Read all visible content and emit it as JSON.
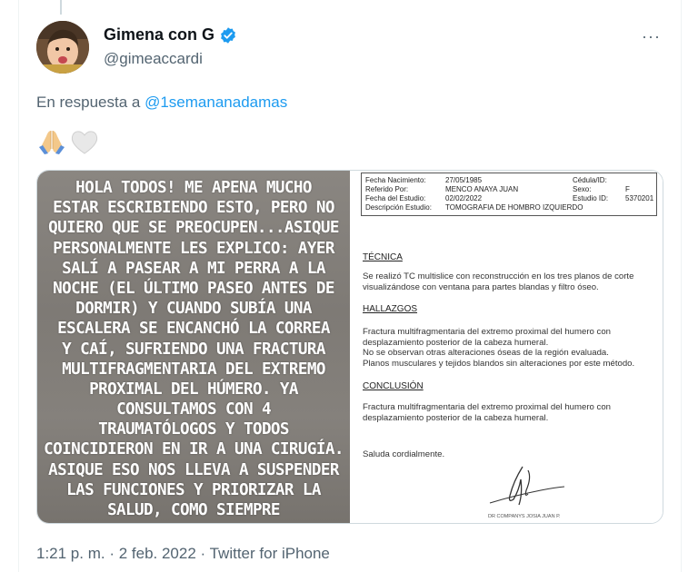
{
  "tweet": {
    "author_name": "Gimena con G",
    "author_handle": "@gimeaccardi",
    "more_menu_label": "···",
    "reply_prefix": "En respuesta a",
    "reply_to": "@1semananadamas",
    "emojis": [
      "pray-emoji",
      "white-heart-emoji"
    ],
    "time": "1:21 p. m.",
    "separator": " · ",
    "date": "2 feb. 2022",
    "source": "Twitter for iPhone"
  },
  "media": {
    "story_lines": [
      "HOLA TODOS! ME APENA MUCHO",
      "ESTAR ESCRIBIENDO ESTO, PERO NO",
      "QUIERO QUE SE PREOCUPEN...ASIQUE",
      "PERSONALMENTE LES EXPLICO: AYER",
      "SALÍ A PASEAR A MI PERRA A LA",
      "NOCHE (EL ÚLTIMO PASEO ANTES DE",
      "DORMIR) Y CUANDO SUBÍA UNA",
      "ESCALERA SE ENCANCHÓ LA CORREA",
      "Y CAÍ, SUFRIENDO UNA FRACTURA",
      "MULTIFRAGMENTARIA DEL EXTREMO",
      "PROXIMAL DEL HÚMERO. YA",
      "CONSULTAMOS CON 4",
      "TRAUMATÓLOGOS Y TODOS",
      "COINCIDIERON EN IR A UNA CIRUGÍA.",
      "ASIQUE ESO NOS LLEVA A SUSPENDER",
      "LAS FUNCIONES Y PRIORIZAR LA",
      "SALUD, COMO SIEMPRE"
    ],
    "report": {
      "header": {
        "fecha_nacimiento_label": "Fecha Nacimiento:",
        "fecha_nacimiento": "27/05/1985",
        "cedula_label": "Cédula/ID:",
        "referido_label": "Referido Por:",
        "referido": "MENCO ANAYA JUAN",
        "sexo_label": "Sexo:",
        "sexo": "F",
        "fecha_estudio_label": "Fecha del Estudio:",
        "fecha_estudio": "02/02/2022",
        "estudio_id_label": "Estudio ID:",
        "estudio_id": "5370201",
        "descripcion_label": "Descripción Estudio:",
        "descripcion": "TOMOGRAFIA DE HOMBRO IZQUIERDO"
      },
      "tecnica_title": "TÉCNICA",
      "tecnica_lines": [
        "Se realizó TC multislice con reconstrucción en los tres planos de corte",
        "visualizándose con ventana para partes blandas y filtro óseo."
      ],
      "hallazgos_title": "HALLAZGOS",
      "hallazgos_lines": [
        "Fractura multifragmentaria del extremo proximal del humero con",
        "desplazamiento posterior de la cabeza humeral.",
        "No se observan otras alteraciones óseas de la región evaluada.",
        "Planos musculares y tejidos blandos  sin alteraciones por este método."
      ],
      "conclusion_title": "CONCLUSIÓN",
      "conclusion_lines": [
        "Fractura multifragmentaria del extremo proximal del humero con",
        "desplazamiento posterior de la cabeza humeral."
      ],
      "closing": "Saluda cordialmente.",
      "signer": "DR COMPANYS JOSIA JUAN P."
    }
  },
  "colors": {
    "accent": "#1d9bf0",
    "secondary_text": "#536471",
    "verified_badge": "#1d9bf0"
  }
}
